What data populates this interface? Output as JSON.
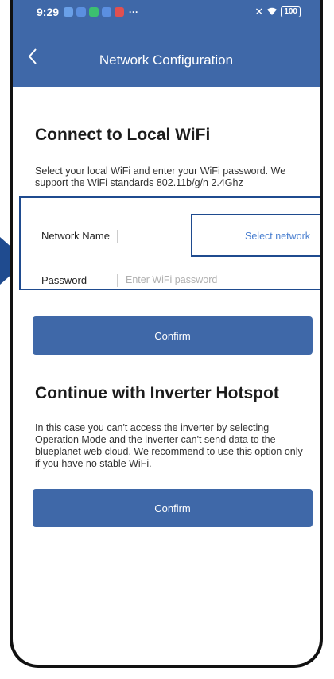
{
  "status_bar": {
    "time": "9:29",
    "icons": [
      "app-icon-blue",
      "app-icon-blue",
      "app-icon-green",
      "app-icon-blue",
      "app-icon-red"
    ],
    "icon_colors": [
      "#6aa0e8",
      "#5b8fe0",
      "#3cc070",
      "#5b8fe0",
      "#e05050"
    ],
    "more": "···",
    "right_icons": [
      "mute-icon",
      "wifi-icon",
      "battery-icon"
    ],
    "battery": "100"
  },
  "header": {
    "back_icon": "chevron-left-icon",
    "title": "Network Configuration",
    "background": "#3f68a8"
  },
  "local_wifi": {
    "heading": "Connect to Local WiFi",
    "description": "Select your local WiFi and enter your WiFi password. We support the WiFi standards 802.11b/g/n 2.4Ghz",
    "network_label": "Network Name",
    "network_select": "Select network",
    "password_label": "Password",
    "password_placeholder": "Enter WiFi password",
    "confirm_label": "Confirm"
  },
  "hotspot": {
    "heading": "Continue with Inverter Hotspot",
    "description": "In this case you can't access the inverter by selecting Operation Mode and the inverter can't send data to the blueplanet web cloud. We recommend to use this option only if you have no stable WiFi.",
    "confirm_label": "Confirm"
  },
  "colors": {
    "accent": "#3f68a8",
    "highlight_border": "#1f4b8f",
    "link": "#4a7fd0"
  }
}
